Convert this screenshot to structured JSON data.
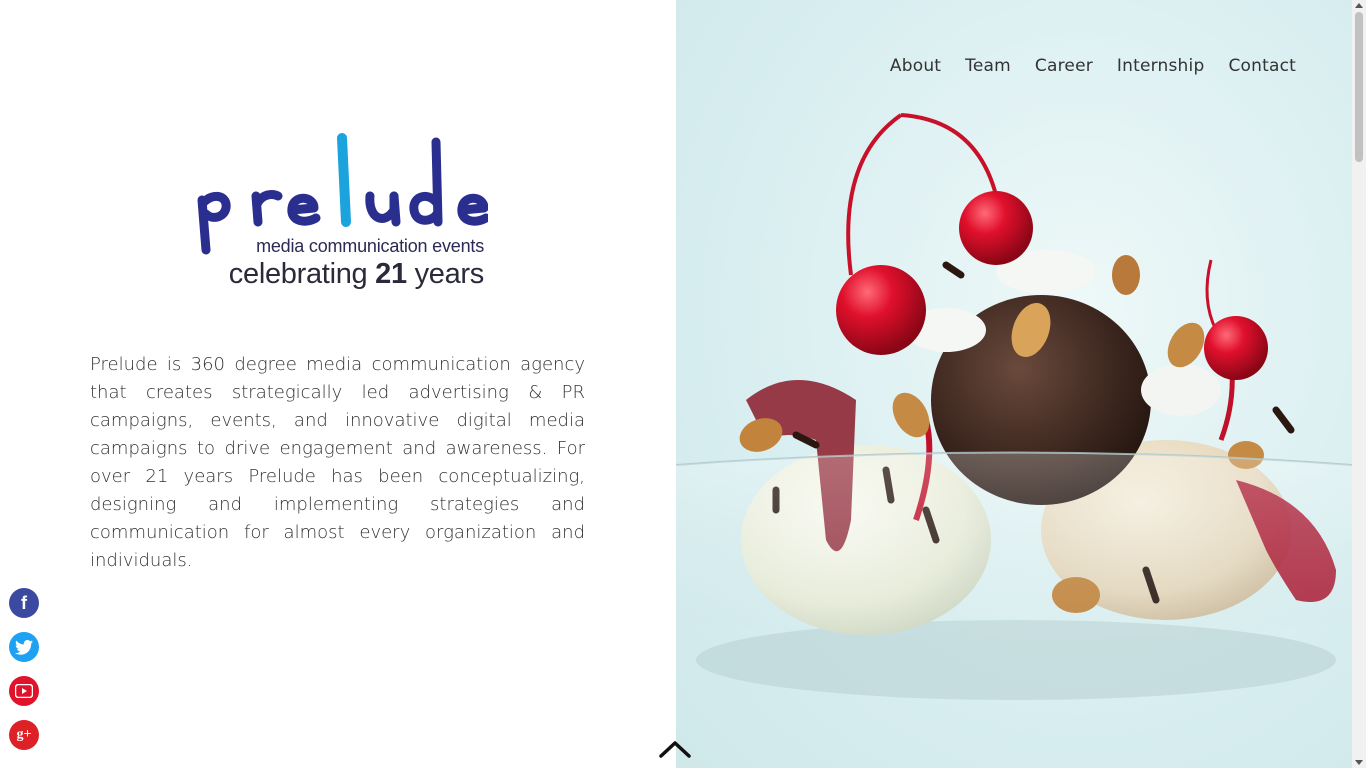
{
  "logo": {
    "wordmark": "prelude",
    "tagline": "media communication events",
    "celebrating_prefix": "celebrating",
    "celebrating_number": "21",
    "celebrating_suffix": "years"
  },
  "intro_text": "Prelude is 360 degree media communication agency that creates strategically led advertising & PR campaigns, events, and innovative digital media campaigns to drive engagement and awareness. For over 21 years Prelude has been conceptualizing, designing and implementing strategies and communication for almost every organization and individuals.",
  "nav": {
    "items": [
      "About",
      "Team",
      "Career",
      "Internship",
      "Contact"
    ]
  },
  "social": {
    "facebook_icon": "facebook-icon",
    "twitter_icon": "twitter-icon",
    "youtube_icon": "youtube-icon",
    "googleplus_icon": "google-plus-icon",
    "facebook_glyph": "f",
    "googleplus_glyph": "g+"
  },
  "colors": {
    "logo_dark_blue": "#2a2f8f",
    "logo_light_blue": "#1ba3dd",
    "facebook": "#3b4aa0",
    "twitter": "#1da1f2",
    "youtube": "#e0132b",
    "googleplus": "#dc2127"
  }
}
